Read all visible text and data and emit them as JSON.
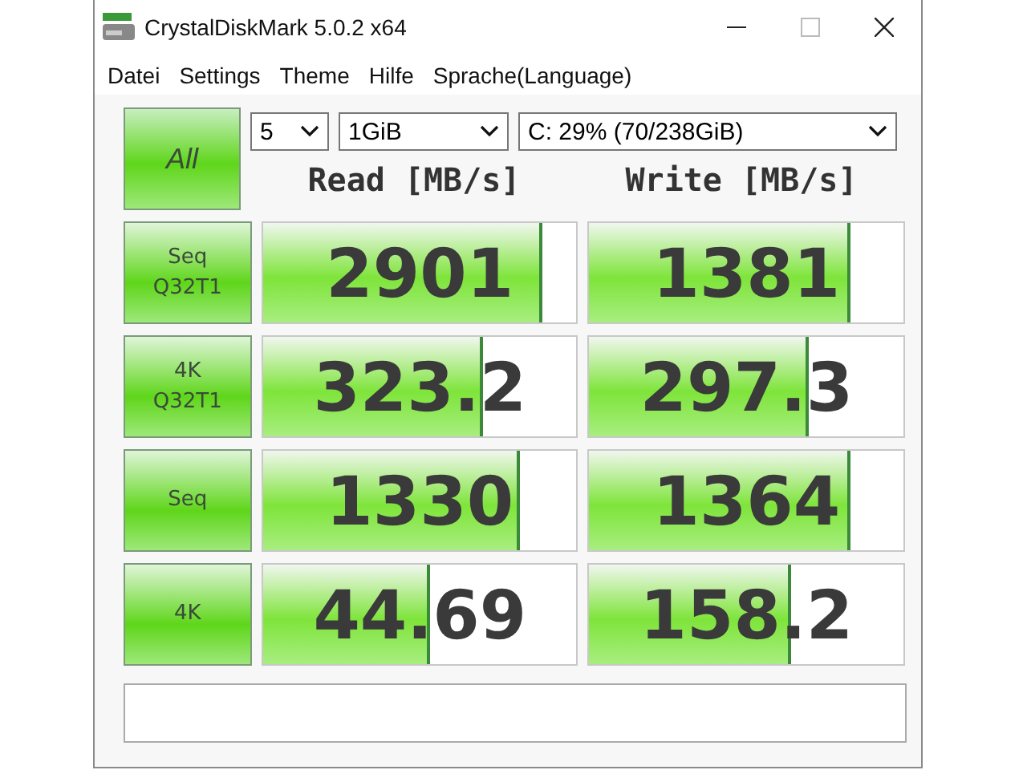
{
  "window": {
    "title": "CrystalDiskMark 5.0.2 x64"
  },
  "menu": [
    "Datei",
    "Settings",
    "Theme",
    "Hilfe",
    "Sprache(Language)"
  ],
  "all_button": "All",
  "selectors": [
    {
      "value": "5"
    },
    {
      "value": "1GiB"
    },
    {
      "value": "C: 29% (70/238GiB)"
    }
  ],
  "columns": [
    "Read [MB/s]",
    "Write [MB/s]"
  ],
  "rows": [
    {
      "test": [
        "Seq",
        "Q32T1"
      ],
      "read": {
        "value": "2901",
        "level": 0.88
      },
      "write": {
        "value": "1381",
        "level": 0.82
      }
    },
    {
      "test": [
        "4K",
        "Q32T1"
      ],
      "read": {
        "value": "323.2",
        "level": 0.69
      },
      "write": {
        "value": "297.3",
        "level": 0.69
      }
    },
    {
      "test": [
        "Seq"
      ],
      "read": {
        "value": "1330",
        "level": 0.81
      },
      "write": {
        "value": "1364",
        "level": 0.82
      }
    },
    {
      "test": [
        "4K"
      ],
      "read": {
        "value": "44.69",
        "level": 0.52
      },
      "write": {
        "value": "158.2",
        "level": 0.63
      }
    }
  ]
}
